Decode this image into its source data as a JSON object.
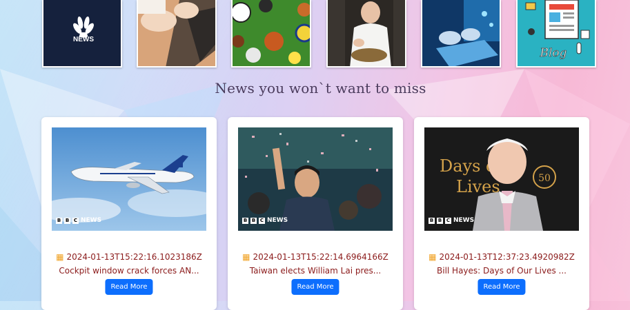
{
  "categories": [
    {
      "name": "News",
      "icon": "news-logo-icon",
      "label": "NEWS"
    },
    {
      "name": "Technology",
      "icon": "laptop-typing-icon"
    },
    {
      "name": "Sports",
      "icon": "sports-balls-icon"
    },
    {
      "name": "Food",
      "icon": "chef-cooking-icon"
    },
    {
      "name": "Tech",
      "icon": "digital-laptop-icon"
    },
    {
      "name": "Blog",
      "icon": "blog-notepad-icon",
      "label": "Blog"
    }
  ],
  "section_title": "News you won`t want to miss",
  "cards": [
    {
      "date": "2024-01-13T15:22:16.1023186Z",
      "headline": "Cockpit window crack forces AN...",
      "button": "Read More",
      "image_watermark": "NEWS"
    },
    {
      "date": "2024-01-13T15:22:14.6964166Z",
      "headline": "Taiwan elects William Lai pres...",
      "button": "Read More",
      "image_watermark": "NEWS"
    },
    {
      "date": "2024-01-13T12:37:23.4920982Z",
      "headline": "Bill Hayes: Days of Our Lives ...",
      "button": "Read More",
      "image_watermark": "NEWS",
      "image_text": "Days of Our Lives",
      "image_badge": "50"
    }
  ]
}
